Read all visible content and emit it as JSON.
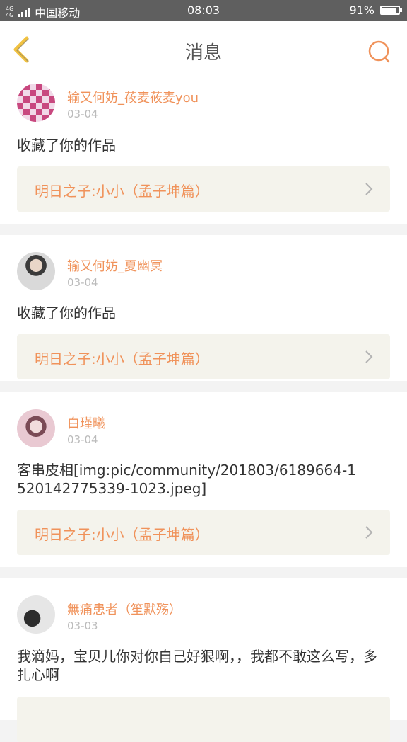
{
  "status_bar": {
    "network_top": "4G",
    "network_bottom": "4G",
    "carrier": "中国移动",
    "time": "08:03",
    "battery": "91%",
    "battery_level": 0.91
  },
  "header": {
    "title": "消息"
  },
  "feed": [
    {
      "name": "输又何妨_莜麦莜麦you",
      "date": "03-04",
      "text": "收藏了你的作品",
      "work": "明日之子:小小（孟子坤篇）"
    },
    {
      "name": "输又何妨_夏幽冥",
      "date": "03-04",
      "text": "收藏了你的作品",
      "work": "明日之子:小小（孟子坤篇）"
    },
    {
      "name": "白瑾曦",
      "date": "03-04",
      "text": "客串皮相[img:pic/community/201803/6189664-1520142775339-1023.jpeg]",
      "work": "明日之子:小小（孟子坤篇）"
    },
    {
      "name": "無痛患者（笙默殇）",
      "date": "03-03",
      "text": "我滴妈，宝贝儿你对你自己好狠啊，，我都不敢这么写，多扎心啊",
      "work": ""
    }
  ],
  "colors": {
    "accent": "#f0925a",
    "back_arrow": "#f1c241",
    "status_bar": "#5f5f5f",
    "work_bg": "#f4f3ec"
  },
  "icons": [
    "back-arrow-icon",
    "search-icon",
    "chevron-right-icon",
    "signal-icon",
    "battery-icon"
  ]
}
